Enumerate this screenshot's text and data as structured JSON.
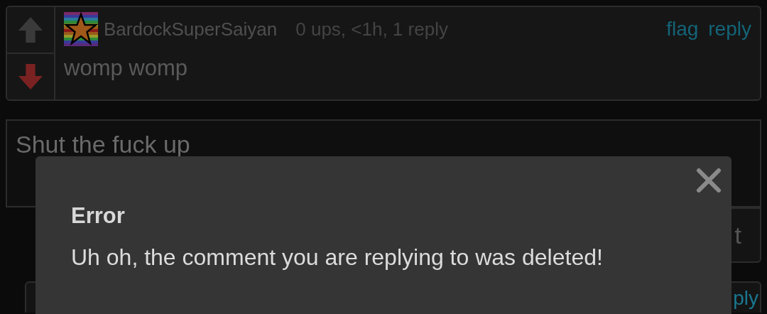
{
  "comment": {
    "votes": [
      {
        "kind": "up",
        "selected": false
      },
      {
        "kind": "down",
        "selected": true
      }
    ],
    "username": "BardockSuperSaiyan",
    "meta": "0 ups, <1h, 1 reply",
    "actions": [
      "flag",
      "reply"
    ],
    "text": "womp womp"
  },
  "reply_box": {
    "value": "Shut the fuck up"
  },
  "submit_button": {
    "label": "t"
  },
  "next_comment": {
    "action": "ply"
  },
  "dialog": {
    "title": "Error",
    "message": "Uh oh, the comment you are replying to was deleted!"
  }
}
